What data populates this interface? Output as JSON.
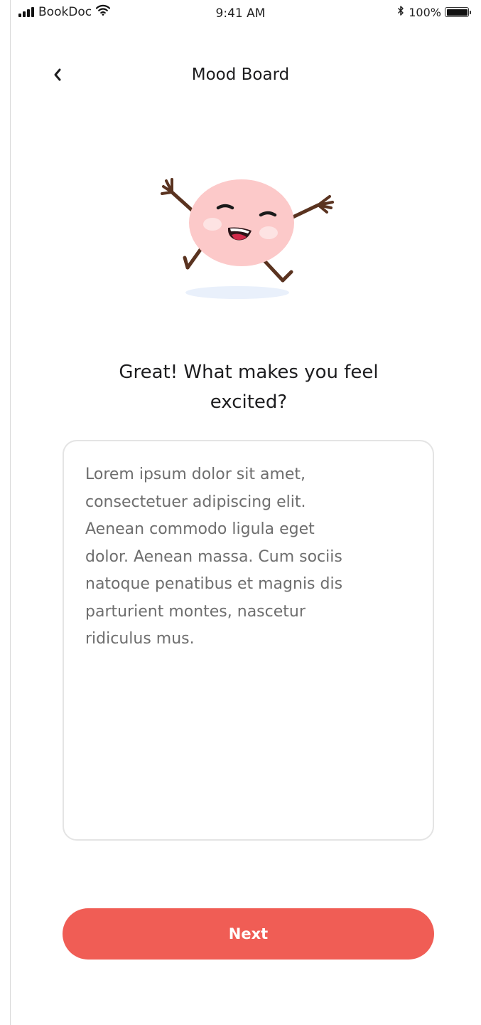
{
  "status_bar": {
    "carrier": "BookDoc",
    "time": "9:41 AM",
    "battery": "100%",
    "icons": [
      "signal-icon",
      "wifi-icon",
      "bluetooth-icon",
      "battery-icon"
    ]
  },
  "header": {
    "title": "Mood Board",
    "back_icon": "chevron-left-icon"
  },
  "mascot": {
    "icon": "excited-mascot-icon",
    "colors": {
      "body": "#fcc9c9",
      "cheeks": "#fde3e3",
      "limbs": "#5a3320",
      "mouth": "#d12a4a",
      "shadow": "#e9f0fb"
    }
  },
  "question": {
    "line1": "Great! What makes you feel",
    "line2": "excited?"
  },
  "answer": {
    "value": "Lorem ipsum dolor sit amet,\nconsectetuer adipiscing elit.\nAenean commodo ligula eget\ndolor. Aenean massa. Cum sociis\nnatoque penatibus et magnis dis\nparturient montes, nascetur\nridiculus mus."
  },
  "actions": {
    "next_label": "Next"
  },
  "theme": {
    "accent": "#f05d55",
    "border": "#e4e4e4",
    "text_muted": "#6e6e6e"
  }
}
